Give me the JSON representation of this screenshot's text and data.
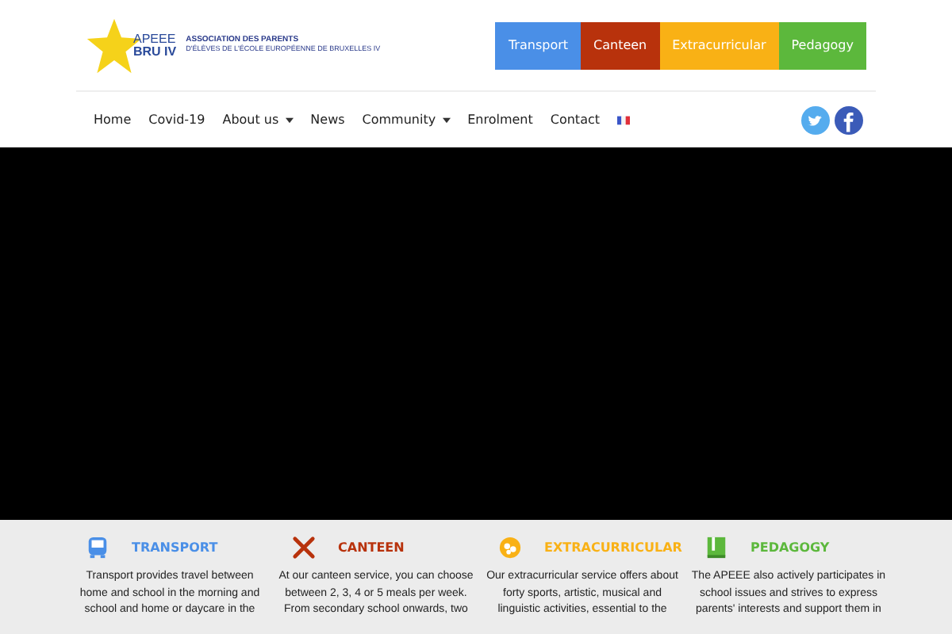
{
  "logo": {
    "short": "APEEE",
    "sub": "BRU IV",
    "line1": "ASSOCIATION DES PARENTS",
    "line2": "D'ÉLÈVES DE L'ÉCOLE EUROPÉENNE DE BRUXELLES IV"
  },
  "service_buttons": [
    {
      "label": "Transport",
      "color": "#4a8fe7"
    },
    {
      "label": "Canteen",
      "color": "#b8320c"
    },
    {
      "label": "Extracurricular",
      "color": "#f9b115"
    },
    {
      "label": "Pedagogy",
      "color": "#5cb83c"
    }
  ],
  "nav": [
    {
      "label": "Home",
      "dropdown": false
    },
    {
      "label": "Covid-19",
      "dropdown": false
    },
    {
      "label": "About us",
      "dropdown": true
    },
    {
      "label": "News",
      "dropdown": false
    },
    {
      "label": "Community",
      "dropdown": true
    },
    {
      "label": "Enrolment",
      "dropdown": false
    },
    {
      "label": "Contact",
      "dropdown": false
    }
  ],
  "services": [
    {
      "title": "TRANSPORT",
      "color": "#4a8fe7",
      "lines": [
        "Transport provides travel between",
        "home and school in the morning and",
        "school and home or daycare in the"
      ]
    },
    {
      "title": "CANTEEN",
      "color": "#b8320c",
      "lines": [
        "At our canteen service, you can choose",
        "between 2, 3, 4 or 5 meals per week.",
        "From secondary school onwards, two"
      ]
    },
    {
      "title": "EXTRACURRICULAR",
      "color": "#f9b115",
      "lines": [
        "Our extracurricular service offers about",
        "forty sports, artistic, musical and",
        "linguistic activities, essential to the"
      ]
    },
    {
      "title": "PEDAGOGY",
      "color": "#5cb83c",
      "lines": [
        "The APEEE also actively participates in",
        "school issues and strives to express",
        "parents' interests and support them in"
      ]
    }
  ]
}
